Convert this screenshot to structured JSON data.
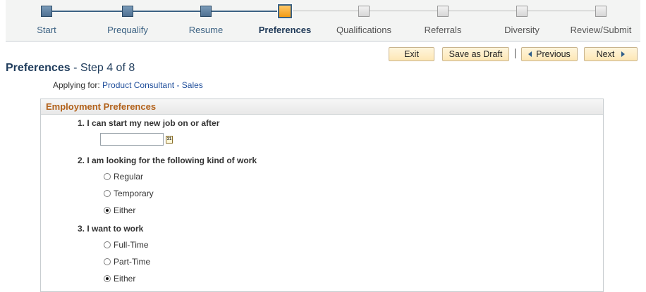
{
  "train": {
    "steps": [
      {
        "label": "Start",
        "status": "complete"
      },
      {
        "label": "Prequalify",
        "status": "complete"
      },
      {
        "label": "Resume",
        "status": "complete"
      },
      {
        "label": "Preferences",
        "status": "current"
      },
      {
        "label": "Qualifications",
        "status": "pending"
      },
      {
        "label": "Referrals",
        "status": "pending"
      },
      {
        "label": "Diversity",
        "status": "pending"
      },
      {
        "label": "Review/Submit",
        "status": "pending"
      }
    ]
  },
  "toolbar": {
    "exit_label": "Exit",
    "save_draft_label": "Save as Draft",
    "separator": "|",
    "previous_label": "Previous",
    "next_label": "Next"
  },
  "header": {
    "title": "Preferences",
    "step_text": "- Step 4 of 8",
    "applying_label": "Applying for:",
    "job_title": "Product Consultant - Sales"
  },
  "section": {
    "title": "Employment Preferences",
    "q1": {
      "label": "1. I can start my new job on or after",
      "date_value": "",
      "calendar_text": "31"
    },
    "q2": {
      "label": "2. I am looking for the following kind of work",
      "options": [
        "Regular",
        "Temporary",
        "Either"
      ],
      "selected": "Either"
    },
    "q3": {
      "label": "3. I want to work",
      "options": [
        "Full-Time",
        "Part-Time",
        "Either"
      ],
      "selected": "Either"
    }
  },
  "colors": {
    "accent": "#3c6283",
    "current_step": "#f29b16",
    "section_title": "#b2611a",
    "button_bg": "#fde7b5",
    "link": "#1f4e9b"
  }
}
